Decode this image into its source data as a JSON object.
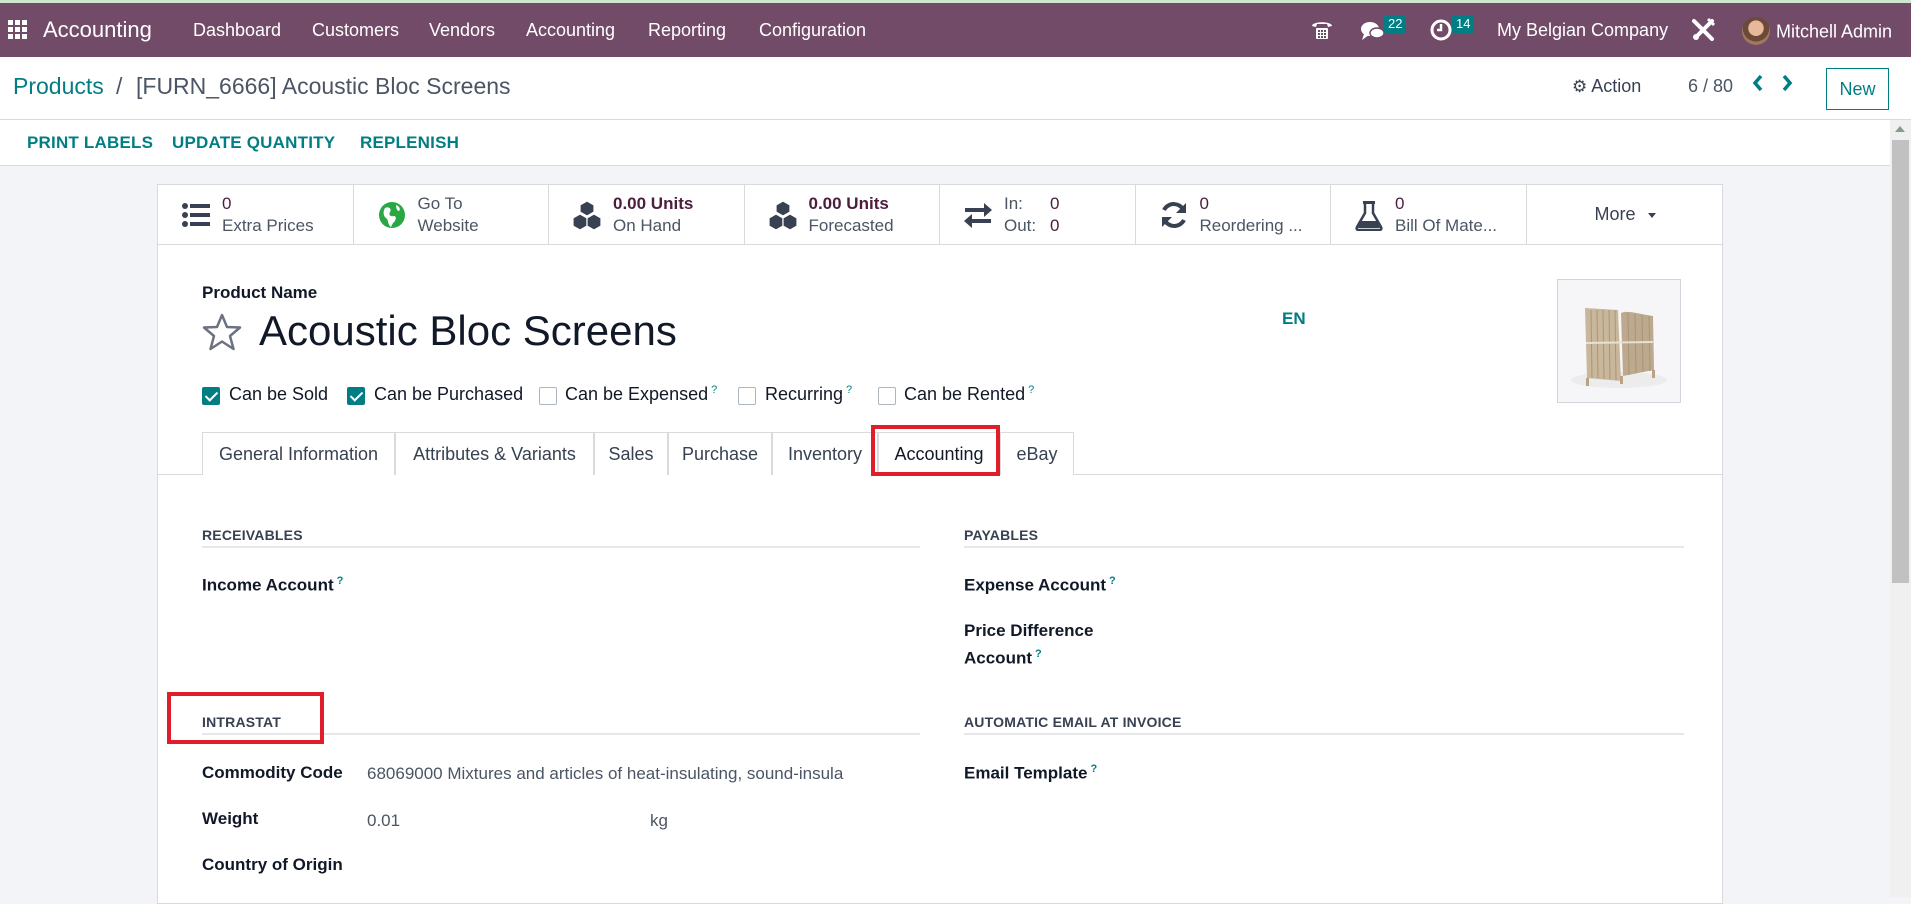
{
  "navbar": {
    "app_name": "Accounting",
    "menu": [
      "Dashboard",
      "Customers",
      "Vendors",
      "Accounting",
      "Reporting",
      "Configuration"
    ],
    "messages_count": "22",
    "activities_count": "14",
    "company": "My Belgian Company",
    "user": "Mitchell Admin",
    "color": "#714B67"
  },
  "breadcrumb": {
    "parent": "Products",
    "separator": "/",
    "current": "[FURN_6666] Acoustic Bloc Screens"
  },
  "control": {
    "action_label": "Action",
    "pager": "6 / 80",
    "new_label": "New"
  },
  "actions": [
    "PRINT LABELS",
    "UPDATE QUANTITY",
    "REPLENISH"
  ],
  "stat_buttons": [
    {
      "icon": "list-icon",
      "line1": "0",
      "line2": "Extra Prices"
    },
    {
      "icon": "globe-icon",
      "line1": "Go To",
      "line2": "Website"
    },
    {
      "icon": "cubes-icon",
      "line1": "0.00 Units",
      "line2": "On Hand"
    },
    {
      "icon": "cubes-icon",
      "line1": "0.00 Units",
      "line2": "Forecasted"
    },
    {
      "icon": "exchange-icon",
      "in_label": "In:",
      "in_value": "0",
      "out_label": "Out:",
      "out_value": "0"
    },
    {
      "icon": "refresh-icon",
      "line1": "0",
      "line2": "Reordering ..."
    },
    {
      "icon": "flask-icon",
      "line1": "0",
      "line2": "Bill Of Mate..."
    },
    {
      "label": "More"
    }
  ],
  "product": {
    "name_label": "Product Name",
    "name": "Acoustic Bloc Screens",
    "lang": "EN",
    "favorite": false
  },
  "flags": [
    {
      "label": "Can be Sold",
      "checked": true,
      "help": false
    },
    {
      "label": "Can be Purchased",
      "checked": true,
      "help": false
    },
    {
      "label": "Can be Expensed",
      "checked": false,
      "help": true
    },
    {
      "label": "Recurring",
      "checked": false,
      "help": true
    },
    {
      "label": "Can be Rented",
      "checked": false,
      "help": true
    }
  ],
  "tabs": [
    {
      "label": "General Information",
      "active": false
    },
    {
      "label": "Attributes & Variants",
      "active": false
    },
    {
      "label": "Sales",
      "active": false
    },
    {
      "label": "Purchase",
      "active": false
    },
    {
      "label": "Inventory",
      "active": false
    },
    {
      "label": "Accounting",
      "active": true
    },
    {
      "label": "eBay",
      "active": false
    }
  ],
  "accounting": {
    "receivables": {
      "title": "RECEIVABLES",
      "income_account_label": "Income Account",
      "income_account_value": ""
    },
    "payables": {
      "title": "PAYABLES",
      "expense_account_label": "Expense Account",
      "expense_account_value": "",
      "price_diff_label_1": "Price Difference",
      "price_diff_label_2": "Account",
      "price_diff_value": ""
    },
    "intrastat": {
      "title": "INTRASTAT",
      "commodity_code_label": "Commodity Code",
      "commodity_code_value": "68069000 Mixtures and articles of heat-insulating, sound-insula",
      "weight_label": "Weight",
      "weight_value": "0.01",
      "weight_unit": "kg",
      "country_label": "Country of Origin",
      "country_value": ""
    },
    "auto_email": {
      "title": "AUTOMATIC EMAIL AT INVOICE",
      "email_template_label": "Email Template",
      "email_template_value": ""
    }
  },
  "help_mark": "?",
  "colors": {
    "accent": "#017E84",
    "highlight": "#E01E2B"
  }
}
